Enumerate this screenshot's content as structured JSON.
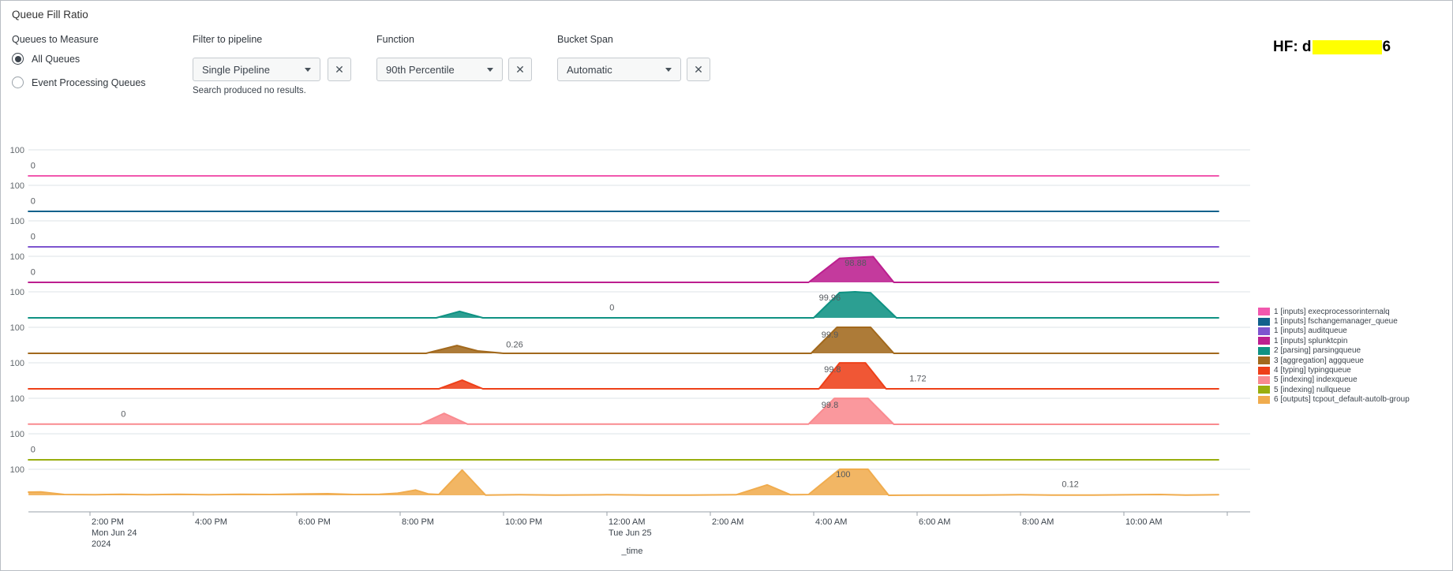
{
  "title": "Queue Fill Ratio",
  "hf_note": {
    "prefix": "HF: d",
    "suffix": "6",
    "redacted": true
  },
  "controls": {
    "queues_to_measure": {
      "label": "Queues to Measure",
      "options": [
        {
          "label": "All Queues",
          "selected": true
        },
        {
          "label": "Event Processing Queues",
          "selected": false
        }
      ]
    },
    "filter_to_pipeline": {
      "label": "Filter to pipeline",
      "value": "Single Pipeline",
      "status": "Search produced no results.",
      "clear_label": "✕"
    },
    "function": {
      "label": "Function",
      "value": "90th Percentile",
      "clear_label": "✕"
    },
    "bucket_span": {
      "label": "Bucket Span",
      "value": "Automatic",
      "clear_label": "✕"
    }
  },
  "legend": [
    {
      "label": "1 [inputs] execprocessorinternalq",
      "color": "#F158AE"
    },
    {
      "label": "1 [inputs] fschangemanager_queue",
      "color": "#10618C"
    },
    {
      "label": "1 [inputs] auditqueue",
      "color": "#7D54CF"
    },
    {
      "label": "1 [inputs] splunktcpin",
      "color": "#BC1F8F"
    },
    {
      "label": "2 [parsing] parsingqueue",
      "color": "#0F9283"
    },
    {
      "label": "3 [aggregation] aggqueue",
      "color": "#A2691D"
    },
    {
      "label": "4 [typing] typingqueue",
      "color": "#EE4019"
    },
    {
      "label": "5 [indexing] indexqueue",
      "color": "#F98A8F"
    },
    {
      "label": "5 [indexing] nullqueue",
      "color": "#99AE0F"
    },
    {
      "label": "6 [outputs] tcpout_default-autolb-group",
      "color": "#F0AC4E"
    }
  ],
  "chart_data": {
    "type": "area",
    "trellis": true,
    "xlabel": "_time",
    "ylim": [
      0,
      100
    ],
    "yticks": [
      100,
      0
    ],
    "x_unit": "hours since Mon Jun 24 2024 12:00 PM",
    "x_range": [
      0.81,
      23.83
    ],
    "grid": "per-row top gridline at 100",
    "legend_position": "right",
    "x_ticks": [
      {
        "t": 2,
        "label": "2:00 PM",
        "sub": [
          "Mon Jun 24",
          "2024"
        ]
      },
      {
        "t": 4,
        "label": "4:00 PM"
      },
      {
        "t": 6,
        "label": "6:00 PM"
      },
      {
        "t": 8,
        "label": "8:00 PM"
      },
      {
        "t": 10,
        "label": "10:00 PM"
      },
      {
        "t": 12,
        "label": "12:00 AM",
        "sub": [
          "Tue Jun 25"
        ]
      },
      {
        "t": 14,
        "label": "2:00 AM"
      },
      {
        "t": 16,
        "label": "4:00 AM"
      },
      {
        "t": 18,
        "label": "6:00 AM"
      },
      {
        "t": 20,
        "label": "8:00 AM"
      },
      {
        "t": 22,
        "label": "10:00 AM"
      },
      {
        "t": 24,
        "label": ""
      }
    ],
    "series": [
      {
        "name": "1 [inputs] execprocessorinternalq",
        "color": "#F158AE",
        "points": [
          [
            0.81,
            0
          ],
          [
            23.83,
            0
          ]
        ],
        "labels": [
          {
            "t": 0.85,
            "v": 20,
            "text": "0"
          }
        ]
      },
      {
        "name": "1 [inputs] fschangemanager_queue",
        "color": "#10618C",
        "points": [
          [
            0.81,
            0
          ],
          [
            23.83,
            0
          ]
        ],
        "labels": [
          {
            "t": 0.85,
            "v": 20,
            "text": "0"
          }
        ]
      },
      {
        "name": "1 [inputs] auditqueue",
        "color": "#7D54CF",
        "points": [
          [
            0.81,
            0
          ],
          [
            23.83,
            0
          ]
        ],
        "labels": [
          {
            "t": 0.85,
            "v": 20,
            "text": "0"
          }
        ]
      },
      {
        "name": "1 [inputs] splunktcpin",
        "color": "#BC1F8F",
        "points": [
          [
            0.81,
            0
          ],
          [
            15.9,
            0
          ],
          [
            16.5,
            92
          ],
          [
            17.15,
            98.88
          ],
          [
            17.55,
            0
          ],
          [
            23.83,
            0
          ]
        ],
        "labels": [
          {
            "t": 0.85,
            "v": 20,
            "text": "0"
          },
          {
            "t": 16.6,
            "v": 55,
            "text": "98.88"
          }
        ]
      },
      {
        "name": "2 [parsing] parsingqueue",
        "color": "#0F9283",
        "points": [
          [
            0.81,
            0
          ],
          [
            8.7,
            0
          ],
          [
            9.15,
            25
          ],
          [
            9.6,
            0
          ],
          [
            16.0,
            0
          ],
          [
            16.5,
            97
          ],
          [
            16.8,
            99.96
          ],
          [
            17.1,
            96
          ],
          [
            17.6,
            0
          ],
          [
            23.83,
            0
          ]
        ],
        "labels": [
          {
            "t": 12.05,
            "v": 20,
            "text": "0"
          },
          {
            "t": 16.1,
            "v": 58,
            "text": "99.96"
          }
        ]
      },
      {
        "name": "3 [aggregation] aggqueue",
        "color": "#A2691D",
        "points": [
          [
            0.81,
            0
          ],
          [
            8.5,
            0
          ],
          [
            9.1,
            30
          ],
          [
            9.5,
            9
          ],
          [
            10.0,
            0
          ],
          [
            15.95,
            0
          ],
          [
            16.45,
            99.9
          ],
          [
            17.1,
            99.9
          ],
          [
            17.55,
            0
          ],
          [
            23.83,
            0
          ]
        ],
        "labels": [
          {
            "t": 10.05,
            "v": 14,
            "text": "0.26"
          },
          {
            "t": 16.15,
            "v": 52,
            "text": "99.9"
          }
        ]
      },
      {
        "name": "4 [typing] typingqueue",
        "color": "#EE4019",
        "points": [
          [
            0.81,
            0
          ],
          [
            8.75,
            0
          ],
          [
            9.2,
            33
          ],
          [
            9.6,
            0
          ],
          [
            16.1,
            0
          ],
          [
            16.5,
            99.8
          ],
          [
            17.0,
            99.8
          ],
          [
            17.4,
            0
          ],
          [
            23.83,
            0
          ]
        ],
        "labels": [
          {
            "t": 16.2,
            "v": 55,
            "text": "99.8"
          },
          {
            "t": 17.85,
            "v": 20,
            "text": "1.72"
          }
        ]
      },
      {
        "name": "5 [indexing] indexqueue",
        "color": "#F98A8F",
        "points": [
          [
            0.81,
            1
          ],
          [
            8.4,
            1
          ],
          [
            8.85,
            42
          ],
          [
            9.3,
            1
          ],
          [
            15.9,
            1
          ],
          [
            16.4,
            99.8
          ],
          [
            17.05,
            99.8
          ],
          [
            17.55,
            0
          ],
          [
            23.83,
            0
          ]
        ],
        "labels": [
          {
            "t": 2.6,
            "v": 20,
            "text": "0"
          },
          {
            "t": 16.15,
            "v": 55,
            "text": "99.8"
          }
        ]
      },
      {
        "name": "5 [indexing] nullqueue",
        "color": "#99AE0F",
        "points": [
          [
            0.81,
            0
          ],
          [
            23.83,
            0
          ]
        ],
        "labels": [
          {
            "t": 0.85,
            "v": 20,
            "text": "0"
          }
        ]
      },
      {
        "name": "6 [outputs] tcpout_default-autolb-group",
        "color": "#F0AC4E",
        "points": [
          [
            0.81,
            12
          ],
          [
            1.05,
            13
          ],
          [
            1.5,
            3
          ],
          [
            2.1,
            2
          ],
          [
            2.6,
            4
          ],
          [
            3.1,
            2
          ],
          [
            3.7,
            4
          ],
          [
            4.3,
            2
          ],
          [
            4.9,
            4
          ],
          [
            5.5,
            3
          ],
          [
            6.1,
            5
          ],
          [
            6.6,
            6
          ],
          [
            7.1,
            3
          ],
          [
            7.6,
            4
          ],
          [
            7.95,
            8
          ],
          [
            8.3,
            20
          ],
          [
            8.55,
            5
          ],
          [
            8.75,
            3
          ],
          [
            9.2,
            97
          ],
          [
            9.65,
            1
          ],
          [
            10.3,
            2
          ],
          [
            11.0,
            1
          ],
          [
            12.0,
            2
          ],
          [
            12.8,
            1
          ],
          [
            13.6,
            1
          ],
          [
            14.5,
            2
          ],
          [
            15.1,
            40
          ],
          [
            15.55,
            2
          ],
          [
            15.9,
            3
          ],
          [
            16.5,
            100
          ],
          [
            17.05,
            100
          ],
          [
            17.45,
            0
          ],
          [
            18.2,
            1
          ],
          [
            19.2,
            1
          ],
          [
            20.0,
            2
          ],
          [
            20.6,
            1
          ],
          [
            21.4,
            1
          ],
          [
            22.2,
            2
          ],
          [
            22.7,
            3
          ],
          [
            23.2,
            1
          ],
          [
            23.83,
            2
          ]
        ],
        "labels": [
          {
            "t": 16.43,
            "v": 60,
            "text": "100"
          },
          {
            "t": 20.8,
            "v": 22,
            "text": "0.12"
          }
        ]
      }
    ]
  }
}
